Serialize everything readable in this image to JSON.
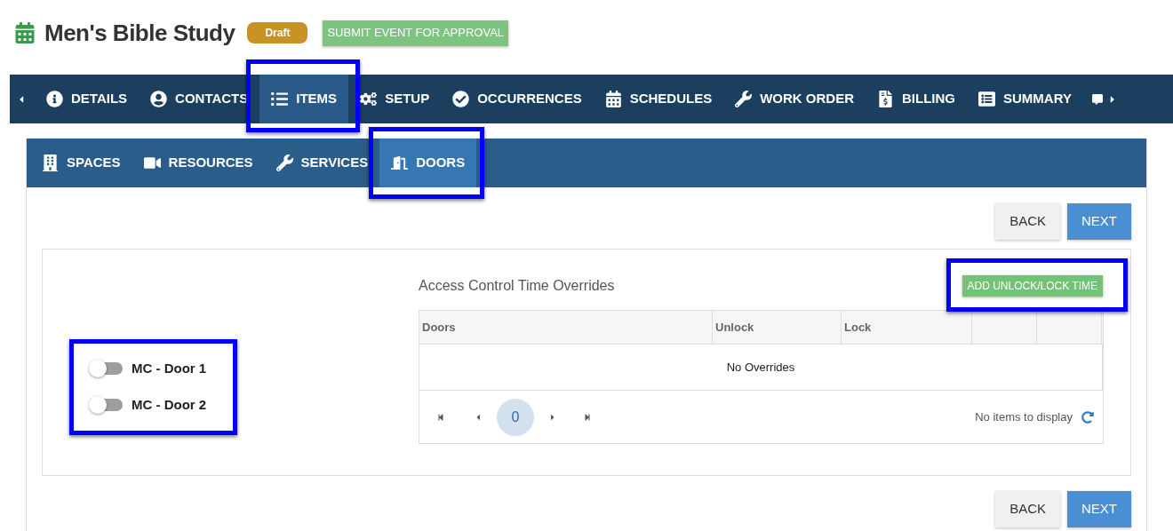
{
  "header": {
    "title": "Men's Bible Study",
    "status_badge": "Draft",
    "submit_button": "SUBMIT EVENT FOR APPROVAL"
  },
  "main_tabs": [
    {
      "label": "DETAILS",
      "selected": false,
      "highlighted": false
    },
    {
      "label": "CONTACTS",
      "selected": false,
      "highlighted": false
    },
    {
      "label": "ITEMS",
      "selected": true,
      "highlighted": true
    },
    {
      "label": "SETUP",
      "selected": false,
      "highlighted": false
    },
    {
      "label": "OCCURRENCES",
      "selected": false,
      "highlighted": false
    },
    {
      "label": "SCHEDULES",
      "selected": false,
      "highlighted": false
    },
    {
      "label": "WORK ORDER",
      "selected": false,
      "highlighted": false
    },
    {
      "label": "BILLING",
      "selected": false,
      "highlighted": false
    },
    {
      "label": "SUMMARY",
      "selected": false,
      "highlighted": false
    }
  ],
  "sub_tabs": [
    {
      "label": "SPACES",
      "selected": false,
      "highlighted": false
    },
    {
      "label": "RESOURCES",
      "selected": false,
      "highlighted": false
    },
    {
      "label": "SERVICES",
      "selected": false,
      "highlighted": false
    },
    {
      "label": "DOORS",
      "selected": true,
      "highlighted": true
    }
  ],
  "top_nav_buttons": {
    "back": "BACK",
    "next": "NEXT"
  },
  "bottom_nav_buttons": {
    "back": "BACK",
    "next": "NEXT"
  },
  "doors": {
    "highlighted": true,
    "items": [
      {
        "name": "MC - Door 1",
        "on": false
      },
      {
        "name": "MC - Door 2",
        "on": false
      }
    ]
  },
  "overrides": {
    "title": "Access Control Time Overrides",
    "add_button": "ADD UNLOCK/LOCK TIME",
    "add_button_highlighted": true,
    "columns": [
      "Doors",
      "Unlock",
      "Lock"
    ],
    "empty_message": "No Overrides",
    "page": "0",
    "pager_info": "No items to display"
  }
}
